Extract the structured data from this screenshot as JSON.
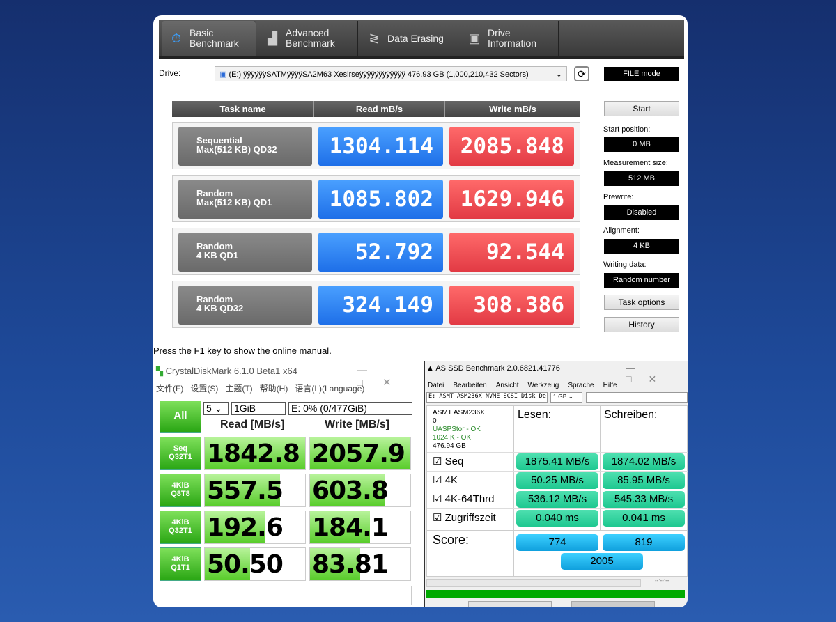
{
  "tool": {
    "tabs": [
      {
        "label1": "Basic",
        "label2": "Benchmark"
      },
      {
        "label1": "Advanced",
        "label2": "Benchmark"
      },
      {
        "label1": "Data Erasing",
        "label2": ""
      },
      {
        "label1": "Drive",
        "label2": "Information"
      }
    ],
    "drive_label": "Drive:",
    "drive_value": "(E:) ÿÿÿÿÿÿSATMÿÿÿÿSA2M63 Xesirseÿÿÿÿÿÿÿÿÿÿÿÿ  476.93 GB (1,000,210,432 Sectors)",
    "mode": "FILE mode",
    "headers": [
      "Task name",
      "Read mB/s",
      "Write mB/s"
    ],
    "rows": [
      {
        "n1": "Sequential",
        "n2": "Max(512 KB) QD32",
        "read": "1304.114",
        "write": "2085.848"
      },
      {
        "n1": "Random",
        "n2": "Max(512 KB) QD1",
        "read": "1085.802",
        "write": "1629.946"
      },
      {
        "n1": "Random",
        "n2": "4 KB QD1",
        "read": "52.792",
        "write": "92.544"
      },
      {
        "n1": "Random",
        "n2": "4 KB QD32",
        "read": "324.149",
        "write": "308.386"
      }
    ],
    "side": {
      "start": "Start",
      "start_pos_label": "Start position:",
      "start_pos": "0 MB",
      "meas_label": "Measurement size:",
      "meas": "512 MB",
      "prewrite_label": "Prewrite:",
      "prewrite": "Disabled",
      "align_label": "Alignment:",
      "align": "4 KB",
      "wdata_label": "Writing data:",
      "wdata": "Random number",
      "task_options": "Task options",
      "history": "History"
    },
    "status": "Press the F1 key to show the online manual."
  },
  "cdm": {
    "title": "CrystalDiskMark 6.1.0 Beta1 x64",
    "menu": [
      "文件(F)",
      "设置(S)",
      "主题(T)",
      "帮助(H)",
      "语言(L)(Language)"
    ],
    "all": "All",
    "count": "5",
    "size": "1GiB",
    "drive": "E: 0% (0/477GiB)",
    "read_h": "Read [MB/s]",
    "write_h": "Write [MB/s]",
    "rows": [
      {
        "l1": "Seq",
        "l2": "Q32T1",
        "read": "1842.8",
        "write": "2057.9",
        "rf": 1,
        "wf": 1
      },
      {
        "l1": "4KiB",
        "l2": "Q8T8",
        "read": "557.5",
        "write": "603.8",
        "rf": 0.75,
        "wf": 0.75
      },
      {
        "l1": "4KiB",
        "l2": "Q32T1",
        "read": "192.6",
        "write": "184.1",
        "rf": 0.6,
        "wf": 0.6
      },
      {
        "l1": "4KiB",
        "l2": "Q1T1",
        "read": "50.50",
        "write": "83.81",
        "rf": 0.45,
        "wf": 0.5
      }
    ]
  },
  "asssd": {
    "title": "AS SSD Benchmark 2.0.6821.41776",
    "menu": [
      "Datei",
      "Bearbeiten",
      "Ansicht",
      "Werkzeug",
      "Sprache",
      "Hilfe"
    ],
    "drive": "E: ASMT ASM236X NVME SCSI Disk De",
    "size": "1 GB",
    "info": [
      "ASMT ASM236X",
      "0",
      "UASPStor - OK",
      "1024 K - OK",
      "476.94 GB"
    ],
    "lesen": "Lesen:",
    "schreiben": "Schreiben:",
    "rows": [
      {
        "n": "Seq",
        "r": "1875.41 MB/s",
        "w": "1874.02 MB/s"
      },
      {
        "n": "4K",
        "r": "50.25 MB/s",
        "w": "85.95 MB/s"
      },
      {
        "n": "4K-64Thrd",
        "r": "536.12 MB/s",
        "w": "545.33 MB/s"
      },
      {
        "n": "Zugriffszeit",
        "r": "0.040 ms",
        "w": "0.041 ms"
      }
    ],
    "score_label": "Score:",
    "score_read": "774",
    "score_write": "819",
    "score_total": "2005",
    "time": "--:--:--",
    "progress": 1
  }
}
